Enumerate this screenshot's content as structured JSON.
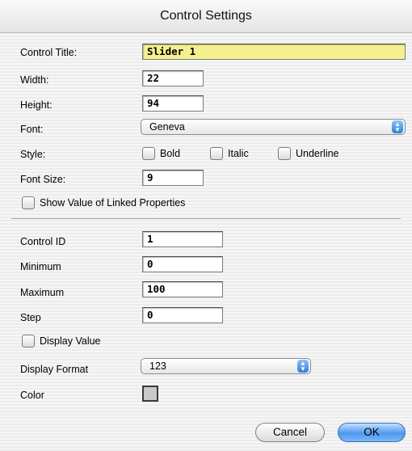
{
  "window": {
    "title": "Control Settings"
  },
  "labels": {
    "control_title": "Control Title:",
    "width": "Width:",
    "height": "Height:",
    "font": "Font:",
    "style": "Style:",
    "font_size": "Font Size:",
    "control_id": "Control ID",
    "minimum": "Minimum",
    "maximum": "Maximum",
    "step": "Step",
    "display_format": "Display Format",
    "color": "Color"
  },
  "fields": {
    "control_title": "Slider 1",
    "width": "22",
    "height": "94",
    "font_size": "9",
    "control_id": "1",
    "minimum": "0",
    "maximum": "100",
    "step": "0"
  },
  "popups": {
    "font": "Geneva",
    "display_format": "123"
  },
  "checkboxes": {
    "bold": "Bold",
    "italic": "Italic",
    "underline": "Underline",
    "show_linked": "Show Value of Linked Properties",
    "display_value": "Display Value"
  },
  "buttons": {
    "cancel": "Cancel",
    "ok": "OK"
  },
  "colors": {
    "title_field_bg": "#f5f08e",
    "swatch": "#c8c8c8",
    "ok_button": "#4f98ec"
  }
}
